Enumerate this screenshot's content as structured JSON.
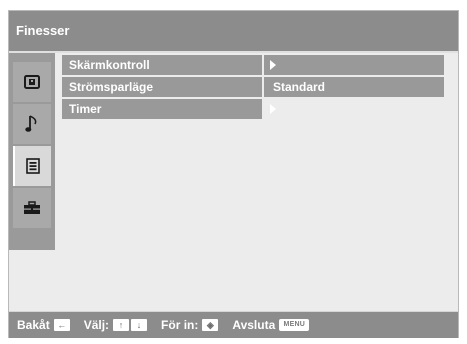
{
  "title": "Finesser",
  "sidebar": {
    "icons": [
      {
        "name": "picture-icon",
        "active": false
      },
      {
        "name": "music-note-icon",
        "active": false
      },
      {
        "name": "settings-list-icon",
        "active": true
      },
      {
        "name": "toolbox-icon",
        "active": false
      }
    ]
  },
  "menu": {
    "items": [
      {
        "label": "Skärmkontroll",
        "value": "",
        "has_submenu": true
      },
      {
        "label": "Strömsparläge",
        "value": "Standard",
        "has_submenu": false
      },
      {
        "label": "Timer",
        "value": "",
        "has_submenu": true
      }
    ]
  },
  "footer": {
    "back_label": "Bakåt",
    "select_label": "Välj:",
    "enter_label": "För in:",
    "exit_label": "Avsluta",
    "menu_key": "MENU",
    "back_key_glyph": "←",
    "up_key_glyph": "↑",
    "down_key_glyph": "↓",
    "enter_key_glyph": "◈"
  },
  "colors": {
    "title_bg": "#8c8c8c",
    "panel_bg": "#ececec",
    "menu_row_bg": "#999999",
    "active_tile_bg": "#d9d9d9",
    "text": "#ffffff"
  }
}
